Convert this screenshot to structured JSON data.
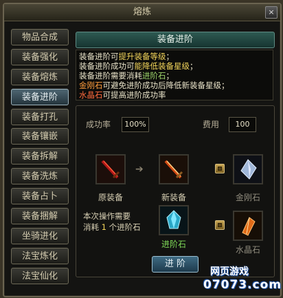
{
  "window": {
    "title": "熔炼",
    "close_label": "×"
  },
  "tabs": [
    {
      "label": "物品合成",
      "active": false
    },
    {
      "label": "装备强化",
      "active": false
    },
    {
      "label": "装备熔炼",
      "active": false
    },
    {
      "label": "装备进阶",
      "active": true
    },
    {
      "label": "装备打孔",
      "active": false
    },
    {
      "label": "装备镶嵌",
      "active": false
    },
    {
      "label": "装备拆解",
      "active": false
    },
    {
      "label": "装备洗炼",
      "active": false
    },
    {
      "label": "装备占卜",
      "active": false
    },
    {
      "label": "装备捆解",
      "active": false
    },
    {
      "label": "坐骑进化",
      "active": false
    },
    {
      "label": "法宝炼化",
      "active": false
    },
    {
      "label": "法宝仙化",
      "active": false
    }
  ],
  "header": {
    "title": "装备进阶"
  },
  "description": {
    "line1_a": "装备进阶可",
    "line1_b": "提升装备等级",
    "line1_c": "；",
    "line2_a": "装备进阶成功可",
    "line2_b": "能降低装备星级",
    "line2_c": "；",
    "line3_a": "装备进阶需要消耗",
    "line3_b": "进阶石",
    "line3_c": "；",
    "line4_a": "金刚石",
    "line4_b": "可避免进阶成功后降低新装备星级；",
    "line5_a": "水晶石",
    "line5_b": "可提高进阶成功率"
  },
  "stats": {
    "success_label": "成功率",
    "success_value": "100%",
    "cost_label": "费用",
    "cost_value": "100"
  },
  "slots": {
    "original_label": "原装备",
    "new_label": "新装备",
    "diamond_label": "金刚石",
    "stone_label": "进阶石",
    "crystal_label": "水晶石"
  },
  "consume": {
    "line1": "本次操作需要",
    "line2_a": "消耗 ",
    "line2_b": "1",
    "line2_c": " 个进阶石"
  },
  "button": {
    "label": "进 阶"
  },
  "watermark": {
    "line1": "网页游戏",
    "line2": "07073.com"
  },
  "colors": {
    "highlight": "#f2d45a",
    "green": "#9cd36a",
    "orange": "#ff9c3c",
    "red": "#ff6b3d",
    "active_tab": "#4e6672"
  },
  "icons": {
    "arrow": "arrow-right-icon",
    "original": "red-sword-icon",
    "new": "flame-sword-icon",
    "diamond": "diamond-gem-icon",
    "stone": "blue-stone-icon",
    "crystal": "orange-crystal-icon"
  }
}
